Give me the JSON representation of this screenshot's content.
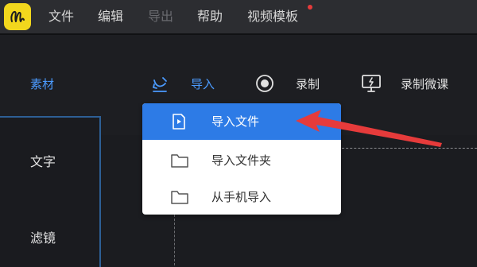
{
  "menu": {
    "items": [
      "文件",
      "编辑",
      "导出",
      "帮助",
      "视频模板"
    ]
  },
  "toolbar": {
    "material_label": "素材",
    "import_label": "导入",
    "record_label": "录制",
    "record_micro_label": "录制微课"
  },
  "sidebar": {
    "items": [
      "文字",
      "滤镜"
    ]
  },
  "dropdown": {
    "items": [
      "导入文件",
      "导入文件夹",
      "从手机导入"
    ]
  },
  "colors": {
    "accent": "#2d7be6",
    "logo": "#f2d71d",
    "arrow": "#e63b3b",
    "active_text": "#4b9bff"
  }
}
